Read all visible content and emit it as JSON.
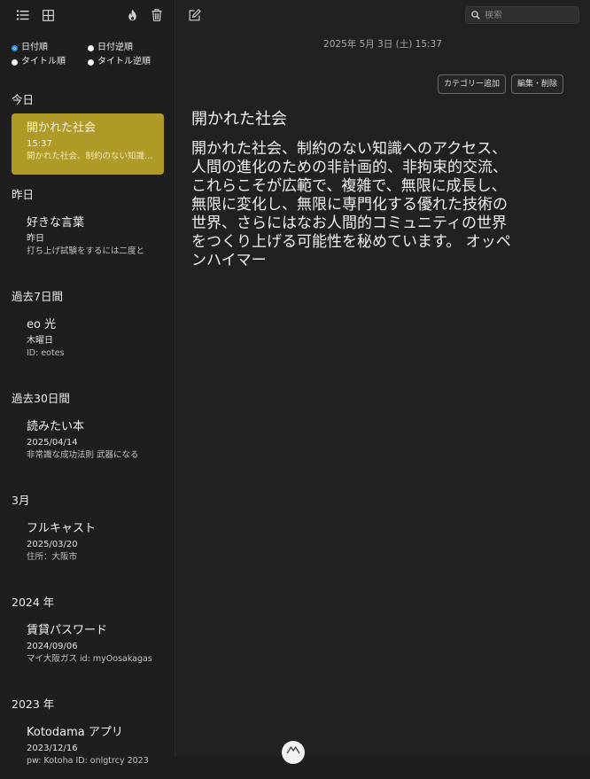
{
  "search": {
    "placeholder": "検索"
  },
  "sort": {
    "date_asc": "日付順",
    "date_desc": "日付逆順",
    "title_asc": "タイトル順",
    "title_desc": "タイトル逆順",
    "selected": "date_asc"
  },
  "groups": [
    {
      "label": "今日",
      "notes": [
        {
          "title": "開かれた社会",
          "date": "15:37",
          "preview": "開かれた社会、制約のない知識へのアクセス",
          "selected": true
        }
      ]
    },
    {
      "label": "昨日",
      "notes": [
        {
          "title": "好きな言葉",
          "date": "昨日",
          "preview": "打ち上げ試験をするには二度と"
        }
      ]
    },
    {
      "label": "過去7日間",
      "notes": [
        {
          "title": "eo 光",
          "date": "木曜日",
          "preview": "ID: eotes"
        }
      ]
    },
    {
      "label": "過去30日間",
      "notes": [
        {
          "title": "読みたい本",
          "date": "2025/04/14",
          "preview": "非常識な成功法則 武器になる"
        }
      ]
    },
    {
      "label": "3月",
      "notes": [
        {
          "title": "フルキャスト",
          "date": "2025/03/20",
          "preview": "住所：大阪市"
        }
      ]
    },
    {
      "label": "2024 年",
      "notes": [
        {
          "title": "賃貸パスワード",
          "date": "2024/09/06",
          "preview": "マイ大阪ガス id: myOosakagas"
        }
      ]
    },
    {
      "label": "2023 年",
      "notes": [
        {
          "title": "Kotodama アプリ",
          "date": "2023/12/16",
          "preview": "pw: Kotoha ID: onlgtrcy 2023"
        }
      ]
    }
  ],
  "editor": {
    "datetime": "2025年 5月 3日 (土) 15:37",
    "add_category_label": "カテゴリー追加",
    "edit_delete_label": "編集・削除",
    "title": "開かれた社会",
    "body": "開かれた社会、制約のない知識へのアクセス、\n人間の進化のための非計画的、非拘束的交流、\nこれらこそが広範で、複雑で、無限に成長し、\n無限に変化し、無限に専門化する優れた技術の\n世界、さらにはなお人間的コミュニティの世界\nをつくり上げる可能性を秘めています。 オッペ\nンハイマー"
  },
  "colors": {
    "selected_note": "#b09a27",
    "radio_accent": "#2e8ff0",
    "background": "#1e1e1e"
  },
  "icons": [
    "list-view-icon",
    "grid-view-icon",
    "flame-icon",
    "trash-icon",
    "edit-icon",
    "search-icon",
    "app-logo-icon"
  ]
}
